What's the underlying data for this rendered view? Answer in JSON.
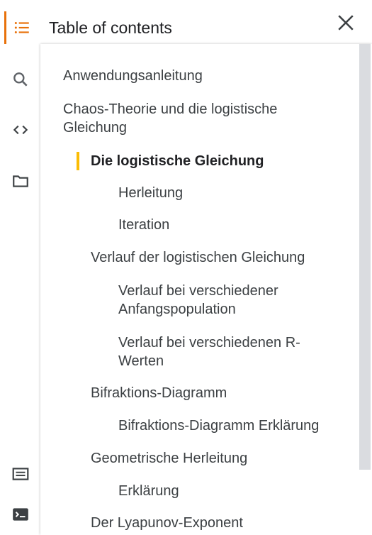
{
  "header": {
    "title": "Table of contents"
  },
  "rail": {
    "icons": [
      "list-icon",
      "search-icon",
      "code-icon",
      "folder-icon",
      "keyboard-icon",
      "terminal-icon"
    ],
    "accent_color": "#e8710a"
  },
  "toc": {
    "current_marker_color": "#fbbc04",
    "items": [
      {
        "text": "Anwendungsanleitung",
        "level": 1
      },
      {
        "text": "Chaos-Theorie und die logistische Gleichung",
        "level": 1
      },
      {
        "text": "Die logistische Gleichung",
        "level": 2,
        "current": true
      },
      {
        "text": "Herleitung",
        "level": 3
      },
      {
        "text": "Iteration",
        "level": 3
      },
      {
        "text": "Verlauf der logistischen Gleichung",
        "level": 2
      },
      {
        "text": "Verlauf bei verschiedener Anfangspopulation",
        "level": 3
      },
      {
        "text": "Verlauf bei verschiedenen R-Werten",
        "level": 3
      },
      {
        "text": "Bifraktions-Diagramm",
        "level": 2
      },
      {
        "text": "Bifraktions-Diagramm Erklärung",
        "level": 3
      },
      {
        "text": "Geometrische Herleitung",
        "level": 2
      },
      {
        "text": "Erklärung",
        "level": 3
      },
      {
        "text": "Der Lyapunov-Exponent",
        "level": 2
      }
    ]
  }
}
